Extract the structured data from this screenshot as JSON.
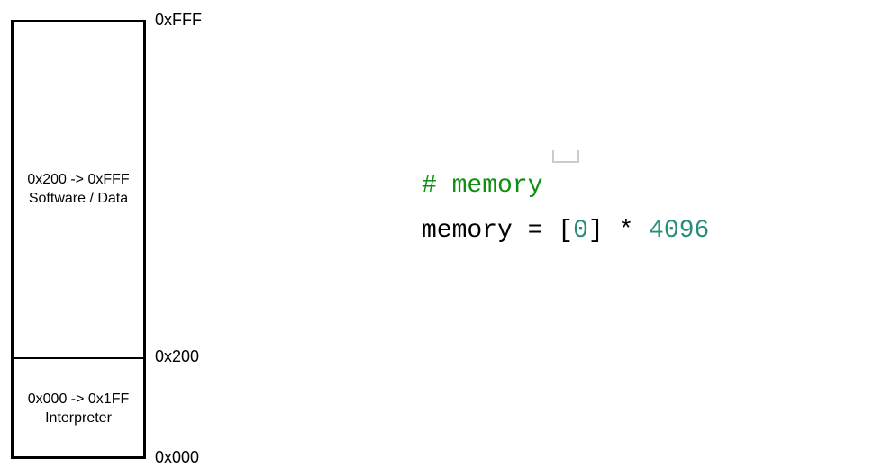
{
  "diagram": {
    "labels": {
      "top_addr": "0xFFF",
      "mid_addr": "0x200",
      "bottom_addr": "0x000"
    },
    "upper": {
      "range": "0x200 -> 0xFFF",
      "label": "Software / Data"
    },
    "lower": {
      "range": "0x000 -> 0x1FF",
      "label": "Interpreter"
    }
  },
  "code": {
    "comment": "# memory",
    "var": "memory",
    "eq": " = ",
    "lbracket": "[",
    "zero": "0",
    "rbracket": "]",
    "star": " * ",
    "size": "4096"
  }
}
